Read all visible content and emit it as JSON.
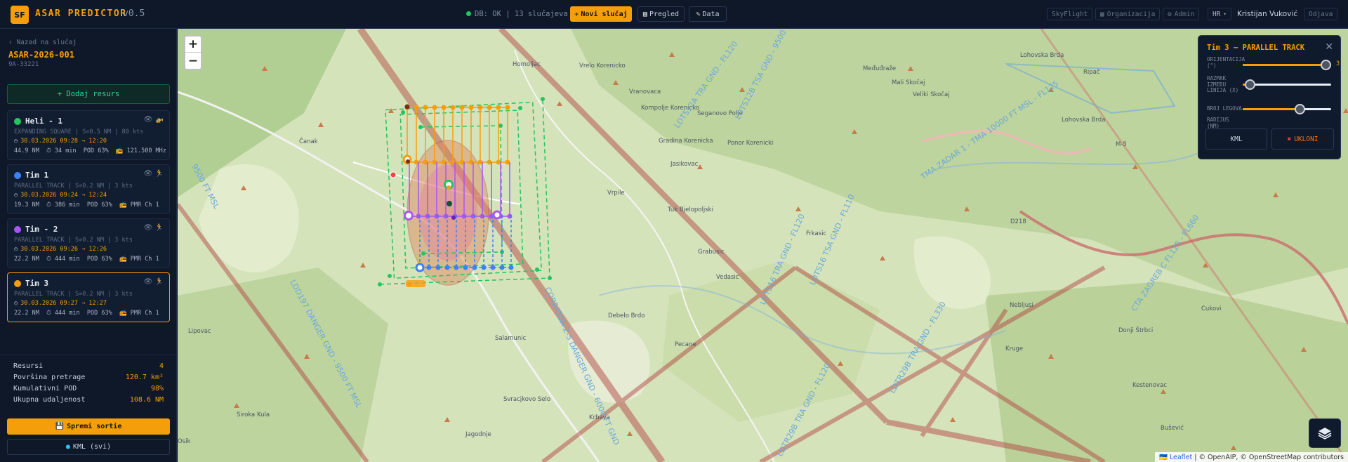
{
  "topbar": {
    "logo": "SF",
    "title": "ASAR PREDICTOR",
    "version": "v0.5",
    "db_status": "DB: OK | 13 slučajeva",
    "new_case": "Novi slučaj",
    "overview": "Pregled",
    "data": "Data",
    "skyflight": "SkyFlight",
    "organization": "Organizacija",
    "admin": "Admin",
    "language": "HR",
    "user": "Kristijan Vuković",
    "logout": "Odjava"
  },
  "sidebar": {
    "back": "‹ Nazad na slučaj",
    "case_id": "ASAR-2026-001",
    "case_sub": "9A-33221",
    "add_resource": "+ Dodaj resurs",
    "resources": [
      {
        "name": "Heli - 1",
        "color": "#22c55e",
        "pattern": "EXPANDING SQUARE | S=0.5 NM | 80 kts",
        "time": "30.03.2026 09:28 → 12:20",
        "distance": "44.9 NM",
        "duration": "34 min",
        "pod": "POD 63%",
        "radio": "121.500 MHz",
        "kind": "heli"
      },
      {
        "name": "Tim 1",
        "color": "#3b82f6",
        "pattern": "PARALLEL TRACK | S=0.2 NM | 3 kts",
        "time": "30.03.2026 09:24 → 12:24",
        "distance": "19.3 NM",
        "duration": "386 min",
        "pod": "POD 63%",
        "radio": "PMR Ch 1",
        "kind": "foot"
      },
      {
        "name": "Tim - 2",
        "color": "#a855f7",
        "pattern": "PARALLEL TRACK | S=0.2 NM | 3 kts",
        "time": "30.03.2026 09:26 → 12:26",
        "distance": "22.2 NM",
        "duration": "444 min",
        "pod": "POD 63%",
        "radio": "PMR Ch 1",
        "kind": "foot"
      },
      {
        "name": "Tim 3",
        "color": "#f59e0b",
        "pattern": "PARALLEL TRACK | S=0.2 NM | 3 kts",
        "time": "30.03.2026 09:27 → 12:27",
        "distance": "22.2 NM",
        "duration": "444 min",
        "pod": "POD 63%",
        "radio": "PMR Ch 1",
        "kind": "foot",
        "active": true
      }
    ],
    "summary": [
      {
        "label": "Resursi",
        "value": "4"
      },
      {
        "label": "Površina pretrage",
        "value": "120.7 km²"
      },
      {
        "label": "Kumulativni POD",
        "value": "98%"
      },
      {
        "label": "Ukupna udaljenost",
        "value": "108.6 NM"
      }
    ],
    "save": "Spremi sortie",
    "kml_all": "KML (svi)"
  },
  "panel": {
    "title": "Tim 3 — PARALLEL TRACK",
    "orientation_label": "ORIJENTACIJA (°)",
    "orientation_value": "3",
    "orientation_level": 0.94,
    "spacing_label": "RAZMAK IZMEĐU LINIJA (X)",
    "spacing_level": 0.08,
    "legs_label": "BROJ LEGOVA",
    "legs_level": 0.64,
    "radius_label": "RADIJUS (NM)",
    "kml": "KML",
    "remove": "UKLONI"
  },
  "map": {
    "zoom_in": "+",
    "zoom_out": "−",
    "attribution_leaflet": "Leaflet",
    "attribution_rest": "| © OpenAIP, © OpenStreetMap contributors",
    "places": [
      "Homoljac",
      "Vrelo Korenicko",
      "Vranovaca",
      "Kompolje Korenicko",
      "Seganovo Polje",
      "Gradina Korenicka",
      "Ponor Korenicki",
      "Jasikovac",
      "Čanak",
      "Vrpile",
      "Tuk Bjelopoljski",
      "Frkasic",
      "Grabusic",
      "Vedasic",
      "Debelo Brdo",
      "Salamunic",
      "Pecane",
      "Svracjkovo Selo",
      "Krbava",
      "Jagodnje",
      "Siroka Kula",
      "Osik",
      "Lipovac",
      "Međuđraže",
      "Mali Skočaj",
      "Veliki Skočaj",
      "Lohovska Brda",
      "Lohovska Brda",
      "Ripač",
      "Nebljusi",
      "Kruge",
      "Cukovi",
      "Donji Štrbci",
      "Kestenovac",
      "Bušević",
      "M-5",
      "D218"
    ],
    "airspace": [
      "LDTS12B TSA GND - 9500 FT MSL",
      "LDTS12A TRA GND - FL120",
      "TMA ZADAR 1 - TMA 10000 FT MSL - FL125",
      "LDTS16 TSA GND - FL110",
      "LDTS16 TRA GND - FL120",
      "LDTR29B TRA GND - FL120",
      "CTA ZAGREB C FL125 - FL660",
      "LDD197 DANGER GND - 9500 FT MSL",
      "CORRIDOR Z-5 DANGER GND - 6000 FT GND",
      "9500 FT MSL",
      "LDTR29B TRA GND - FL330"
    ]
  }
}
